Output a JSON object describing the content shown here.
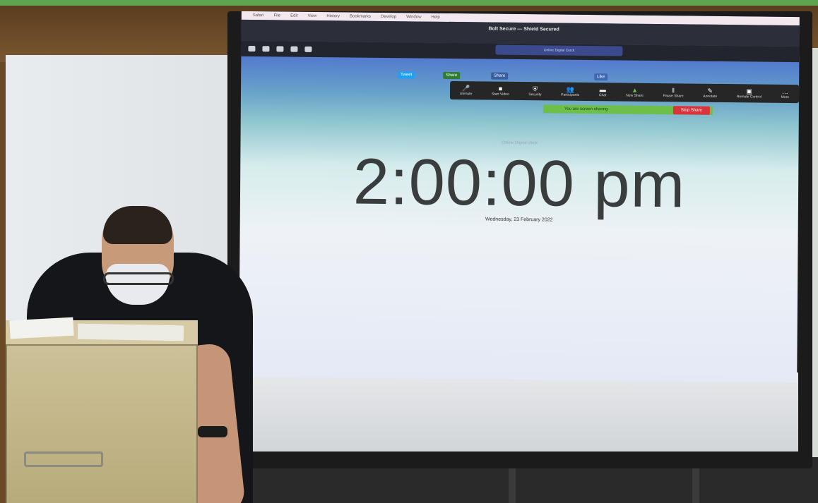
{
  "browser": {
    "menubar": [
      "Safari",
      "File",
      "Edit",
      "View",
      "History",
      "Bookmarks",
      "Develop",
      "Window",
      "Help"
    ],
    "page_title": "Bolt Secure — Shield Secured",
    "address": "Online Digital Clock"
  },
  "zoom_toolbar": {
    "items": [
      {
        "label": "Unmute",
        "glyph": "🎤"
      },
      {
        "label": "Start Video",
        "glyph": "■"
      },
      {
        "label": "Security",
        "glyph": "⛨"
      },
      {
        "label": "Participants",
        "glyph": "👥"
      },
      {
        "label": "Chat",
        "glyph": "▬"
      },
      {
        "label": "New Share",
        "glyph": "▲"
      },
      {
        "label": "Pause Share",
        "glyph": "‖"
      },
      {
        "label": "Annotate",
        "glyph": "✎"
      },
      {
        "label": "Remote Control",
        "glyph": "▣"
      },
      {
        "label": "More",
        "glyph": "…"
      }
    ],
    "share_status": "You are screen sharing",
    "stop_share": "Stop Share"
  },
  "page": {
    "caption": "Online Digital clock",
    "time": "2:00:00 pm",
    "date": "Wednesday, 23 February 2022",
    "social": [
      "Tweet",
      "Share",
      "Share",
      "Like"
    ]
  },
  "colors": {
    "border_frame": "#5fa550",
    "share_green": "#6cc04a",
    "stop_red": "#d9343b"
  }
}
